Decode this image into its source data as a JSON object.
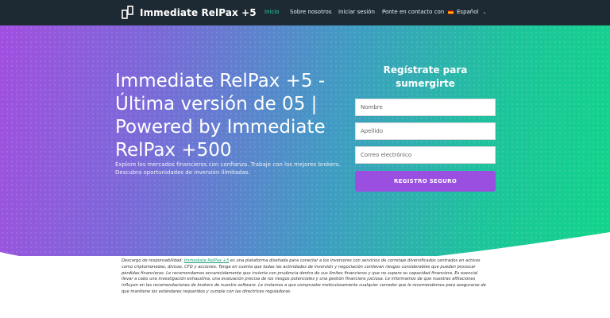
{
  "brand": {
    "name": "Immediate RelPax +5",
    "logo_icon": "logo-icon"
  },
  "nav": {
    "items": [
      "Inicio",
      "Sobre nosotros",
      "Iniciar sesión",
      "Ponte en contacto con"
    ],
    "active_index": 0,
    "language": "Español",
    "flag_icon": "spain-flag-icon",
    "chevron_icon": "chevron-down-icon"
  },
  "hero": {
    "title": "Immediate RelPax +5 - Última versión de 05 | Powered by Immediate RelPax +500",
    "subtitle": "Explore los mercados financieros con confianza. Trabaje con los mejores brokers. Descubra oportunidades de inversión ilimitadas."
  },
  "form": {
    "title": "Regístrate para sumergirte",
    "first_name_placeholder": "Nombre",
    "last_name_placeholder": "Apellido",
    "email_placeholder": "Correo electrónico",
    "submit_label": "REGISTRO SEGURO"
  },
  "disclaimer": {
    "prefix": "Descargo de responsabilidad: ",
    "link": "Immediate RelPax +5",
    "body": " es una plataforma diseñada para conectar a los inversores con servicios de corretaje diversificados centrados en activos como criptomonedas, divisas, CFD y acciones. Tenga en cuenta que todas las actividades de inversión y negociación conllevan riesgos considerables que pueden provocar pérdidas financieras. Le recomendamos encarecidamente que invierta con prudencia dentro de sus límites financieros y que no supere su capacidad financiera. Es esencial llevar a cabo una investigación exhaustiva, una evaluación precisa de los riesgos potenciales y una gestión financiera juiciosa. Le informamos de que nuestras afiliaciones influyen en las recomendaciones de brokers de nuestro software. Le instamos a que compruebe meticulosamente cualquier corredor que le recomendemos para asegurarse de que mantiene los estándares requeridos y cumple con las directrices reguladoras."
  },
  "colors": {
    "topbar": "#1e2a33",
    "accent_green": "#22d39a",
    "button_purple": "#9b4fe0",
    "gradient_start": "#a14fe0",
    "gradient_end": "#12d48a"
  }
}
